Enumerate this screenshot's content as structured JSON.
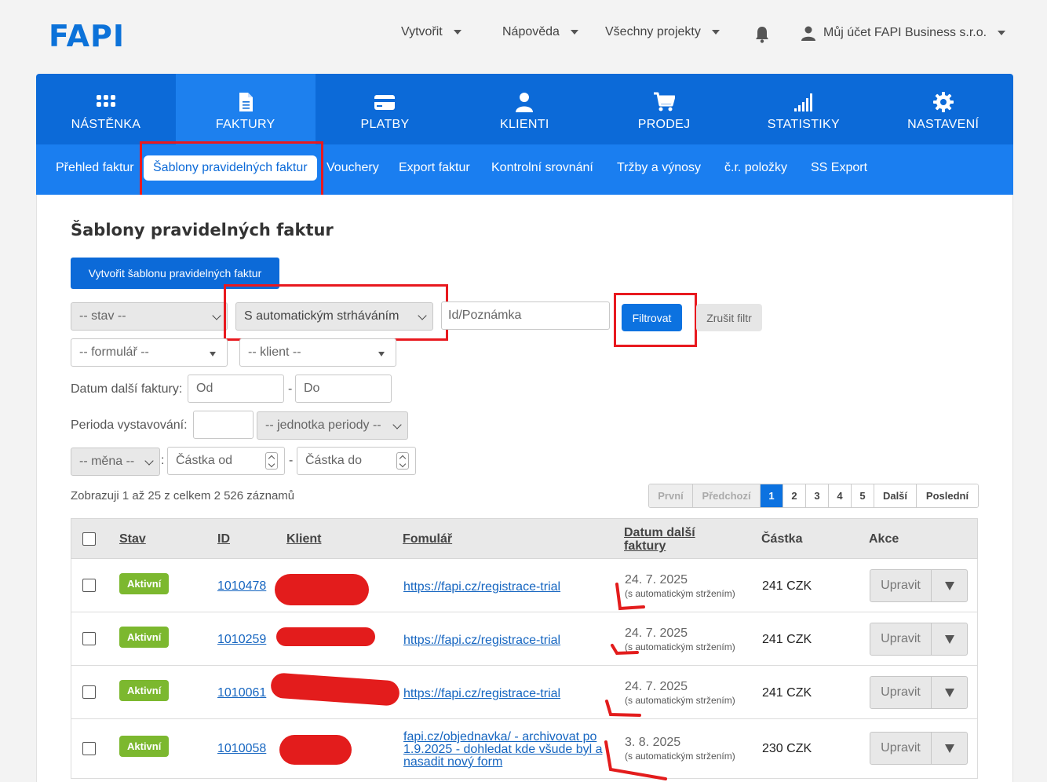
{
  "brand": {
    "logo": "FAPI"
  },
  "topnav": {
    "create": "Vytvořit",
    "help": "Nápověda",
    "projects": "Všechny projekty",
    "account": "Můj účet FAPI Business s.r.o."
  },
  "mainnav": [
    {
      "label": "NÁSTĚNKA",
      "icon": "grid-icon"
    },
    {
      "label": "FAKTURY",
      "icon": "document-icon",
      "active": true
    },
    {
      "label": "PLATBY",
      "icon": "credit-card-icon"
    },
    {
      "label": "KLIENTI",
      "icon": "user-icon"
    },
    {
      "label": "PRODEJ",
      "icon": "cart-icon"
    },
    {
      "label": "STATISTIKY",
      "icon": "signal-bars-icon"
    },
    {
      "label": "NASTAVENÍ",
      "icon": "gear-icon"
    }
  ],
  "subnav": {
    "overview": "Přehled faktur",
    "templates": "Šablony pravidelných faktur",
    "vouchers": "Vouchery",
    "export": "Export faktur",
    "compare": "Kontrolní srovnání",
    "revenue": "Tržby a výnosy",
    "items": "č.r. položky",
    "ss_export": "SS Export"
  },
  "page": {
    "title": "Šablony pravidelných faktur",
    "create_button": "Vytvořit šablonu pravidelných faktur"
  },
  "filters": {
    "status": "-- stav --",
    "charging": "S automatickým strháváním",
    "id_note_placeholder": "Id/Poznámka",
    "filter_button": "Filtrovat",
    "clear_button": "Zrušit filtr",
    "form": "-- formulář --",
    "client": "-- klient --",
    "next_date_label": "Datum další faktury:",
    "date_from_placeholder": "Od",
    "date_sep": "-",
    "date_to_placeholder": "Do",
    "period_label": "Perioda vystavování:",
    "period_unit": "-- jednotka periody --",
    "currency": "-- měna --",
    "currency_sep": ":",
    "amount_from_placeholder": "Částka od",
    "amount_sep": "-",
    "amount_to_placeholder": "Částka do"
  },
  "records_text": "Zobrazuji 1 až 25 z celkem 2 526 záznamů",
  "pagination": [
    "První",
    "Předchozí",
    "1",
    "2",
    "3",
    "4",
    "5",
    "Další",
    "Poslední"
  ],
  "table": {
    "headers": {
      "status": "Stav",
      "id": "ID",
      "client": "Klient",
      "form": "Fomulář",
      "next_date": "Datum další faktury",
      "amount": "Částka",
      "actions": "Akce"
    },
    "rows": [
      {
        "status": "Aktivní",
        "id": "1010478",
        "form": "https://fapi.cz/registrace-trial",
        "date": "24. 7. 2025",
        "date_note": "(s automatickým stržením)",
        "amount": "241 CZK",
        "edit": "Upravit"
      },
      {
        "status": "Aktivní",
        "id": "1010259",
        "form": "https://fapi.cz/registrace-trial",
        "date": "24. 7. 2025",
        "date_note": "(s automatickým stržením)",
        "amount": "241 CZK",
        "edit": "Upravit"
      },
      {
        "status": "Aktivní",
        "id": "1010061",
        "form": "https://fapi.cz/registrace-trial",
        "date": "24. 7. 2025",
        "date_note": "(s automatickým stržením)",
        "amount": "241 CZK",
        "edit": "Upravit"
      },
      {
        "status": "Aktivní",
        "id": "1010058",
        "form": "fapi.cz/objednavka/ - archivovat po 1.9.2025 - dohledat kde všude byl a nasadit nový form",
        "date": "3. 8. 2025",
        "date_note": "(s automatickým stržením)",
        "amount": "230 CZK",
        "edit": "Upravit"
      }
    ]
  },
  "colors": {
    "primary": "#0c6ad8",
    "subnav": "#1a7ef0",
    "active_badge": "#7cb82f",
    "annotation": "#e31c1c"
  }
}
